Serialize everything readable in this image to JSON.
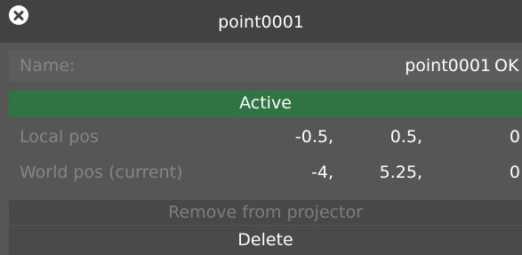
{
  "window": {
    "title": "point0001"
  },
  "name_row": {
    "label": "Name:",
    "value": "point0001",
    "ok_label": "OK"
  },
  "active_label": "Active",
  "local_pos": {
    "label": "Local pos",
    "x": "-0.5,",
    "y": "0.5,",
    "z": "0"
  },
  "world_pos": {
    "label": "World pos (current)",
    "x": "-4,",
    "y": "5.25,",
    "z": "0"
  },
  "remove_label": "Remove from projector",
  "delete_label": "Delete",
  "colors": {
    "panel": "#565656",
    "titlebar": "#424242",
    "active": "#2f7543",
    "label_text": "#858585"
  },
  "icons": {
    "close": "close-icon"
  }
}
